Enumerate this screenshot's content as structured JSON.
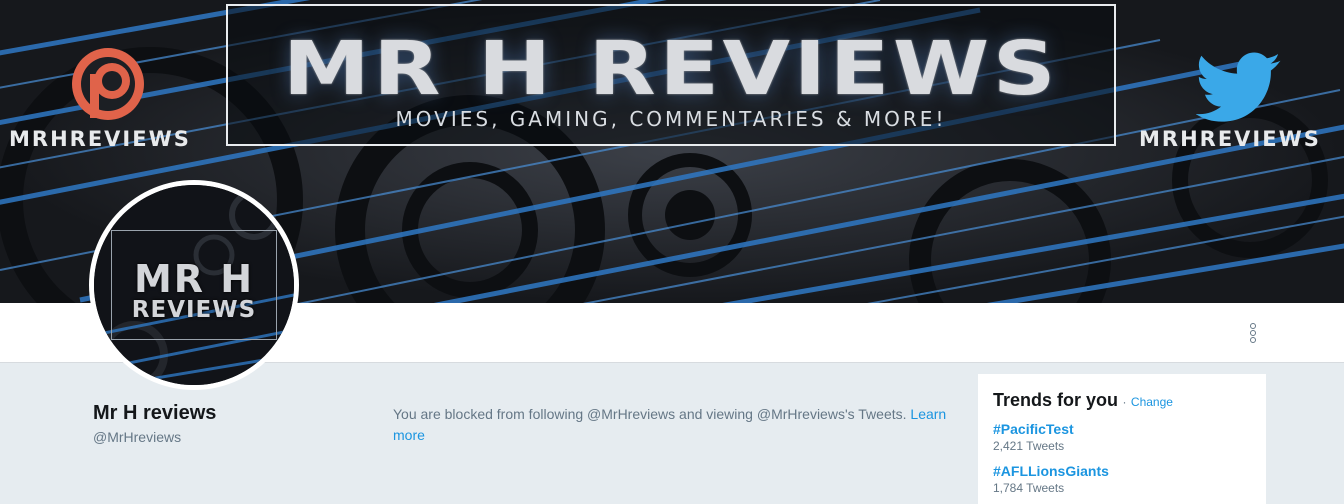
{
  "banner": {
    "title": "MR H REVIEWS",
    "subtitle": "MOVIES, GAMING, COMMENTARIES & MORE!",
    "patreon_label": "MRHREVIEWS",
    "twitter_label": "MRHREVIEWS",
    "accent_blue": "#2f78c4",
    "patreon_color": "#e0634a",
    "twitter_color": "#3aa8e8"
  },
  "avatar": {
    "line1": "MR H",
    "line2": "REVIEWS"
  },
  "profile": {
    "name": "Mr H reviews",
    "handle": "@MrHreviews"
  },
  "blocked": {
    "message": "You are blocked from following @MrHreviews and viewing @MrHreviews's Tweets.",
    "link": "Learn more"
  },
  "trends": {
    "title": "Trends for you",
    "separator": "·",
    "change_label": "Change",
    "items": [
      {
        "name": "#PacificTest",
        "count": "2,421 Tweets"
      },
      {
        "name": "#AFLLionsGiants",
        "count": "1,784 Tweets"
      }
    ]
  },
  "navbar": {
    "more_icon": "more-vertical-icon"
  }
}
